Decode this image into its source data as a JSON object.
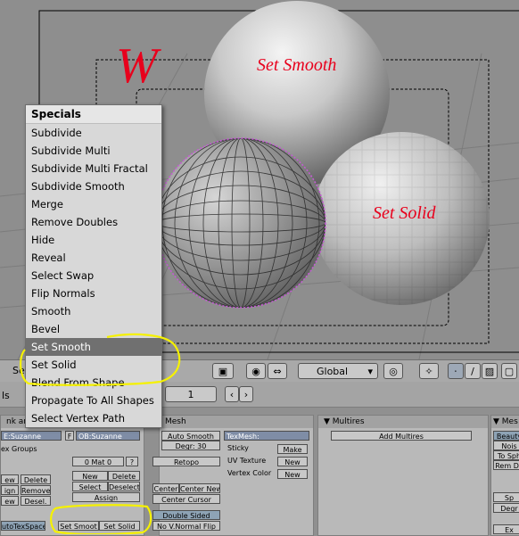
{
  "viewport": {
    "w_label": "W",
    "smooth_label": "Set Smooth",
    "solid_label": "Set Solid"
  },
  "menu": {
    "title": "Specials",
    "items": [
      {
        "label": "Subdivide"
      },
      {
        "label": "Subdivide Multi"
      },
      {
        "label": "Subdivide Multi Fractal"
      },
      {
        "label": "Subdivide Smooth"
      },
      {
        "label": "Merge"
      },
      {
        "label": "Remove Doubles"
      },
      {
        "label": "Hide"
      },
      {
        "label": "Reveal"
      },
      {
        "label": "Select Swap"
      },
      {
        "label": "Flip Normals"
      },
      {
        "label": "Smooth"
      },
      {
        "label": "Bevel"
      },
      {
        "label": "Set Smooth",
        "highlighted": true
      },
      {
        "label": "Set Solid"
      },
      {
        "label": "Blend From Shape"
      },
      {
        "label": "Propagate To All Shapes"
      },
      {
        "label": "Select Vertex Path"
      }
    ]
  },
  "header": {
    "partial_left": "Se",
    "orientation": "Global"
  },
  "panelbar": {
    "partial_left": "ls",
    "frame": "1"
  },
  "link_panel": {
    "title": "nk and",
    "me": "E:Suzanne",
    "f": "F",
    "ob": "OB:Suzanne",
    "vertex_groups": "ex Groups",
    "mat": "0 Mat 0",
    "question": "?",
    "new_partial": "ew",
    "delete1": "Delete",
    "new": "New",
    "delete2": "Delete",
    "assign_partial": "ign",
    "remove": "Remove",
    "select": "Select",
    "deselect": "Deselect",
    "new3_partial": "ew",
    "desel": "Desel.",
    "assign": "Assign",
    "autotexspace": "utoTexSpace",
    "set_smooth": "Set Smoot",
    "set_solid": "Set Solid"
  },
  "mesh_panel": {
    "title": "Mesh",
    "auto_smooth": "Auto Smooth",
    "degr": "Degr: 30",
    "refopo": "Retopo",
    "center": "Center",
    "center_new": "Center New",
    "center_cursor": "Center Cursor",
    "double_sided": "Double Sided",
    "no_vnormal_flip": "No V.Normal Flip",
    "texmesh": "TexMesh:",
    "sticky": "Sticky",
    "make": "Make",
    "uv_texture": "UV Texture",
    "new1": "New",
    "vertex_color": "Vertex Color",
    "new2": "New"
  },
  "multires_panel": {
    "title": "Multires",
    "add": "Add Multires"
  },
  "right_panel": {
    "title": "Mes",
    "beauty": "Beauty",
    "noise": "Nois",
    "to_sphere": "To Sph",
    "rem_doubles": "Rem Do",
    "sp": "Sp",
    "degr": "Degr",
    "ex": "Ex"
  },
  "colors": {
    "highlight": "#707070",
    "annotation_yellow": "#f5f100",
    "annotation_red": "#e8001c",
    "wire_pink": "#c45bd3"
  }
}
